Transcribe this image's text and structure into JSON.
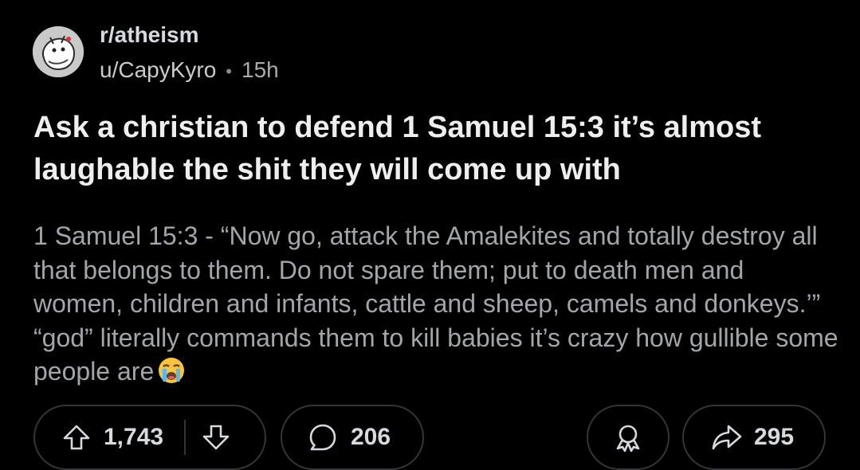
{
  "post": {
    "subreddit": "r/atheism",
    "author": "u/CapyKyro",
    "separator": "•",
    "age": "15h",
    "title": "Ask a christian to defend 1 Samuel 15:3 it’s almost laughable the shit they will come up with",
    "body": "1 Samuel 15:3 - “Now go, attack the Amalekites and totally destroy all that belongs to them. Do not spare them; put to death men and women, children and infants, cattle and sheep, camels and donkeys.’” “god” literally commands them to kill babies it’s crazy how gullible some people are",
    "body_emoji": "loudly-crying-face"
  },
  "actions": {
    "upvote_count": "1,743",
    "comment_count": "206",
    "share_count": "295"
  },
  "icons": {
    "avatar": "subreddit-avatar-icon",
    "upvote": "upvote-arrow-icon",
    "downvote": "downvote-arrow-icon",
    "comment": "comment-bubble-icon",
    "award": "award-icon",
    "share": "share-arrow-icon"
  },
  "colors": {
    "background": "#000000",
    "title": "#eeeeef",
    "body": "#a3a6a8",
    "pill_border": "#343536"
  }
}
